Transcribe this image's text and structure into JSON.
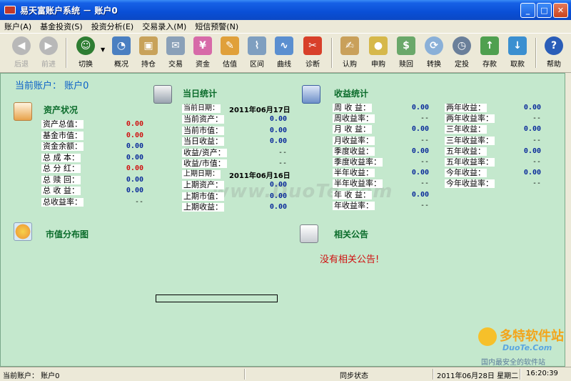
{
  "window": {
    "title": "易天富账户系统 － 账户0"
  },
  "menu": [
    "账户(A)",
    "基金投资(S)",
    "投资分析(E)",
    "交易录入(M)",
    "短信预警(N)"
  ],
  "toolbar": {
    "back": "后退",
    "forward": "前进",
    "switch": "切换",
    "overview": "概况",
    "holding": "持仓",
    "trade": "交易",
    "funds": "资金",
    "valuation": "估值",
    "range": "区间",
    "curve": "曲线",
    "diagnose": "诊断",
    "subscribe": "认购",
    "purchase": "申购",
    "redeem": "赎回",
    "convert": "转换",
    "fixed_invest": "定投",
    "deposit": "存款",
    "withdraw": "取款",
    "help": "帮助"
  },
  "account": {
    "title": "当前账户：  账户0"
  },
  "assets": {
    "title": "资产状况",
    "rows": [
      {
        "label": "资产总值：",
        "value": "0.00"
      },
      {
        "label": "基金市值：",
        "value": "0.00"
      },
      {
        "label": "资金余额：",
        "value": "0.00"
      },
      {
        "label": "总 成 本：",
        "value": "0.00"
      },
      {
        "label": "总 分 红：",
        "value": "0.00"
      },
      {
        "label": "总 赎 回：",
        "value": "0.00"
      },
      {
        "label": "总 收 益：",
        "value": "0.00"
      },
      {
        "label": "总收益率：",
        "value": "--"
      }
    ]
  },
  "daily": {
    "title": "当日统计",
    "current_date_label": "当前日期：",
    "current_date": "2011年06月17日",
    "rows1": [
      {
        "label": "当前资产：",
        "value": "0.00"
      },
      {
        "label": "当前市值：",
        "value": "0.00"
      },
      {
        "label": "当日收益：",
        "value": "0.00"
      },
      {
        "label": "收益/资产：",
        "value": "--"
      },
      {
        "label": "收益/市值：",
        "value": "--"
      }
    ],
    "prev_date_label": "上期日期：",
    "prev_date": "2011年06月16日",
    "rows2": [
      {
        "label": "上期资产：",
        "value": "0.00"
      },
      {
        "label": "上期市值：",
        "value": "0.00"
      },
      {
        "label": "上期收益：",
        "value": "0.00"
      }
    ]
  },
  "income": {
    "title": "收益统计",
    "col1": [
      {
        "label": "周 收 益：",
        "value": "0.00"
      },
      {
        "label": "周收益率：",
        "value": "--"
      },
      {
        "label": "月 收 益：",
        "value": "0.00"
      },
      {
        "label": "月收益率：",
        "value": "--"
      },
      {
        "label": "季度收益：",
        "value": "0.00"
      },
      {
        "label": "季度收益率：",
        "value": "--"
      },
      {
        "label": "半年收益：",
        "value": "0.00"
      },
      {
        "label": "半年收益率：",
        "value": "--"
      },
      {
        "label": "年 收 益：",
        "value": "0.00"
      },
      {
        "label": "年收益率：",
        "value": "--"
      }
    ],
    "col2": [
      {
        "label": "两年收益：",
        "value": "0.00"
      },
      {
        "label": "两年收益率：",
        "value": "--"
      },
      {
        "label": "三年收益：",
        "value": "0.00"
      },
      {
        "label": "三年收益率：",
        "value": "--"
      },
      {
        "label": "五年收益：",
        "value": "0.00"
      },
      {
        "label": "五年收益率：",
        "value": "--"
      },
      {
        "label": "今年收益：",
        "value": "0.00"
      },
      {
        "label": "今年收益率：",
        "value": "--"
      }
    ]
  },
  "distribution": {
    "title": "市值分布图"
  },
  "announce": {
    "title": "相关公告",
    "message": "没有相关公告!"
  },
  "watermark": "www.DuoTe.com",
  "logo": {
    "main": "多特软件站",
    "url": "DuoTe.Com",
    "tagline": "国内最安全的软件站"
  },
  "status": {
    "account": "当前账户：  账户0",
    "sync": "同步状态",
    "date": "2011年06月28日 星期二",
    "time": "16:20:39"
  },
  "colors": {
    "panel": "#c4e8cd",
    "title_blue": "#0b61c7",
    "section_green": "#0a6b2a",
    "value_red": "#d01010",
    "value_blue": "#0a2a9a"
  }
}
